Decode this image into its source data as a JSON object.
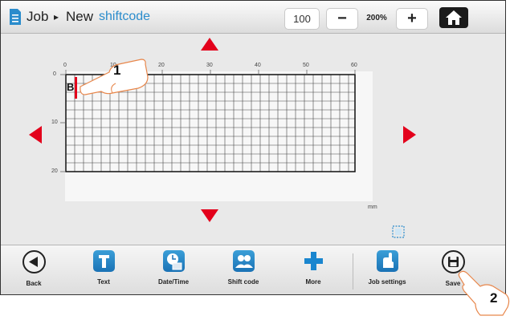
{
  "breadcrumb": {
    "job": "Job",
    "separator": "▸",
    "new": "New",
    "current": "shiftcode"
  },
  "zoom": {
    "value": "100",
    "minus_label": "−",
    "level": "200%",
    "plus_label": "+"
  },
  "editor": {
    "ruler_x": [
      "0",
      "10",
      "20",
      "30",
      "40",
      "50",
      "60"
    ],
    "ruler_y": [
      "0",
      "10",
      "20"
    ],
    "unit": "mm",
    "text_char": "B"
  },
  "toolbar": {
    "back": "Back",
    "text": "Text",
    "datetime": "Date/Time",
    "shiftcode": "Shift code",
    "more": "More",
    "job_settings": "Job settings",
    "save": "Save"
  },
  "callouts": [
    "1",
    "2"
  ],
  "colors": {
    "accent_blue": "#2a8ccc",
    "arrow_red": "#e3001b",
    "icon_blue": "#1a72b5"
  }
}
